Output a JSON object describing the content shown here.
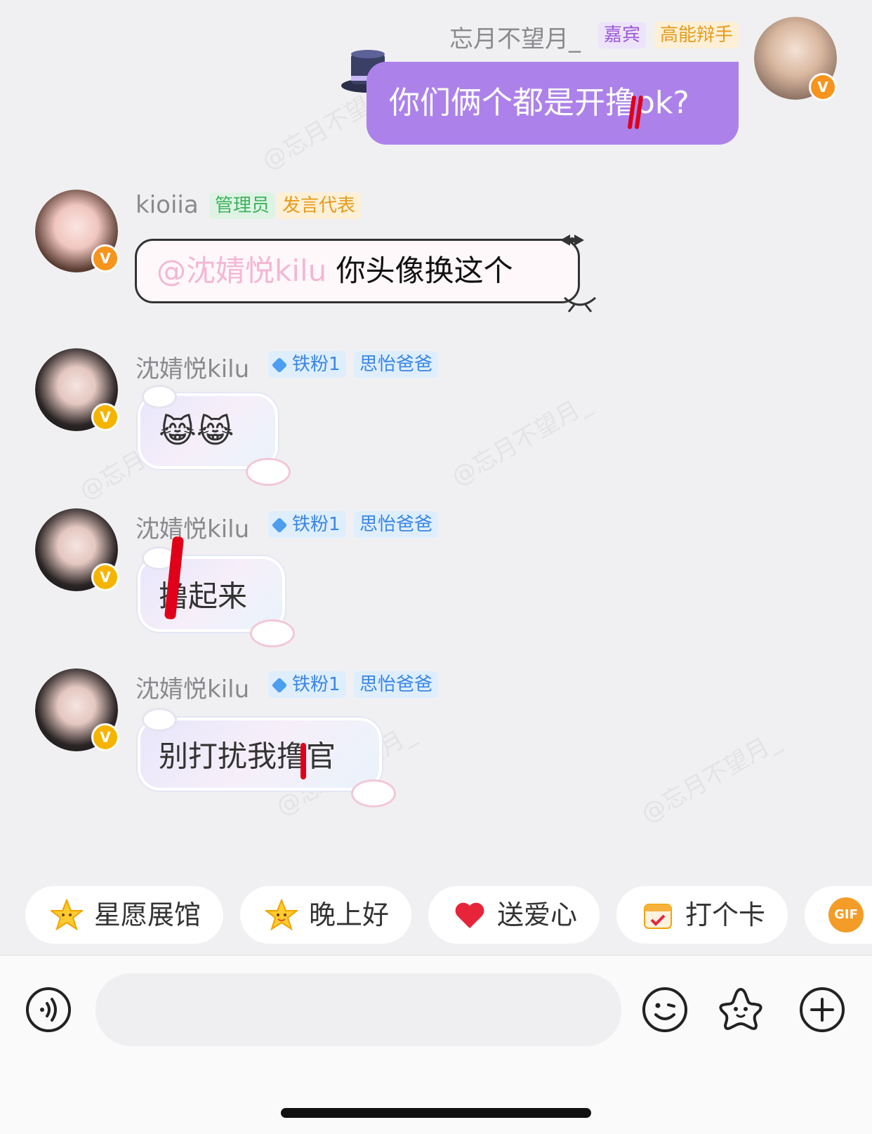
{
  "watermark_text": "@忘月不望月_",
  "messages": [
    {
      "sender": "忘月不望月_",
      "tags": [
        "嘉宾",
        "高能辩手"
      ],
      "text": "你们俩个都是开撸ok?",
      "badge": "V"
    },
    {
      "sender": "kioiia",
      "tags": [
        "管理员",
        "发言代表"
      ],
      "mention": "@沈婧悦kilu",
      "text": "你头像换这个",
      "badge": "V"
    },
    {
      "sender": "沈婧悦kilu",
      "tags": [
        "铁粉1",
        "思怡爸爸"
      ],
      "text": "😹😹",
      "badge": "V"
    },
    {
      "sender": "沈婧悦kilu",
      "tags": [
        "铁粉1",
        "思怡爸爸"
      ],
      "text": "撸起来",
      "badge": "V"
    },
    {
      "sender": "沈婧悦kilu",
      "tags": [
        "铁粉1",
        "思怡爸爸"
      ],
      "text": "别打扰我撸官",
      "badge": "V"
    }
  ],
  "quick_replies": [
    {
      "label": "星愿展馆",
      "icon": "star-smile-icon"
    },
    {
      "label": "晚上好",
      "icon": "star-face-icon"
    },
    {
      "label": "送爱心",
      "icon": "heart-icon"
    },
    {
      "label": "打个卡",
      "icon": "calendar-icon"
    },
    {
      "label": "GIF",
      "icon": "gif-icon"
    }
  ],
  "input": {
    "placeholder": "",
    "tools": [
      "voice-icon",
      "emoji-icon",
      "sticker-star-icon",
      "plus-icon"
    ]
  },
  "colors": {
    "own_bubble": "#ac82ea",
    "guest_tag": "#9b59d8",
    "admin_tag": "#3bb35b",
    "fan_tag": "#3a86e6",
    "speaker_tag": "#e69a1a",
    "red_mark": "#e0001a"
  }
}
